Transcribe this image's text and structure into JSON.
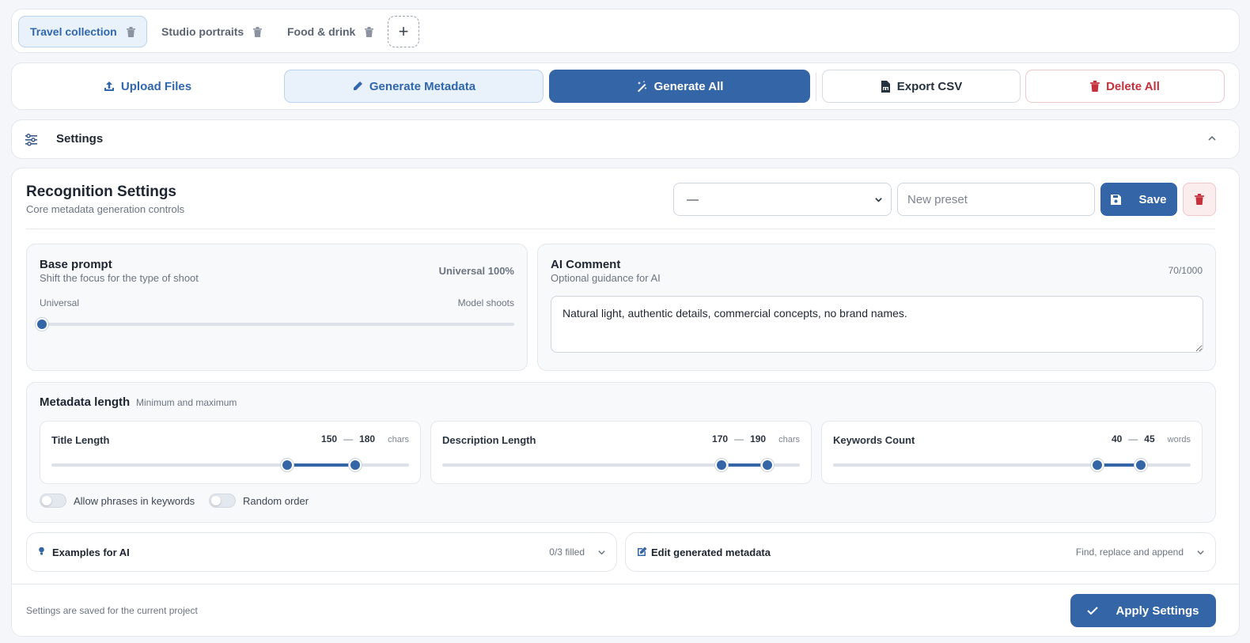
{
  "tabs": [
    {
      "label": "Travel collection",
      "active": true
    },
    {
      "label": "Studio portraits",
      "active": false
    },
    {
      "label": "Food & drink",
      "active": false
    }
  ],
  "add_tab_label": "+",
  "toolbar": {
    "upload_label": "Upload Files",
    "generate_metadata_label": "Generate Metadata",
    "generate_all_label": "Generate All",
    "export_label": "Export CSV",
    "delete_all_label": "Delete All"
  },
  "settings": {
    "title": "Settings"
  },
  "recognition": {
    "title": "Recognition Settings",
    "subtitle": "Core metadata generation controls",
    "preset_selected": "—",
    "preset_placeholder": "New preset",
    "save_label": "Save"
  },
  "base_prompt": {
    "title": "Base prompt",
    "subtitle": "Shift the focus for the type of shoot",
    "value_label": "Universal 100%",
    "left_label": "Universal",
    "right_label": "Model shoots",
    "slider_value": 0
  },
  "ai_comment": {
    "title": "AI Comment",
    "subtitle": "Optional guidance for AI",
    "counter": "70/1000",
    "text": "Natural light, authentic details, commercial concepts, no brand names."
  },
  "metadata_length": {
    "title": "Metadata length",
    "subtitle": "Minimum and maximum",
    "ranges": [
      {
        "label": "Title Length",
        "min": "150",
        "max": "180",
        "dash": "—",
        "unit": "chars",
        "fill_start": 0.66,
        "fill_end": 0.85
      },
      {
        "label": "Description Length",
        "min": "170",
        "max": "190",
        "dash": "—",
        "unit": "chars",
        "fill_start": 0.78,
        "fill_end": 0.91
      },
      {
        "label": "Keywords Count",
        "min": "40",
        "max": "45",
        "dash": "—",
        "unit": "words",
        "fill_start": 0.74,
        "fill_end": 0.86
      }
    ],
    "toggles": [
      {
        "label": "Allow phrases in keywords",
        "on": false
      },
      {
        "label": "Random order",
        "on": false
      }
    ]
  },
  "examples": {
    "title": "Examples for AI",
    "status": "0/3 filled"
  },
  "edit_metadata": {
    "title": "Edit generated metadata",
    "status": "Find, replace and append"
  },
  "footer": {
    "note": "Settings are saved for the current project",
    "apply_label": "Apply Settings"
  },
  "colors": {
    "accent": "#3465a7",
    "danger": "#c4313d",
    "accent_light": "#e9f1fb"
  },
  "icons": [
    "trash-icon",
    "plus-icon",
    "upload-icon",
    "pencil-icon",
    "magic-wand-icon",
    "csv-file-icon",
    "sliders-icon",
    "chevron-up-icon",
    "chevron-down-icon",
    "floppy-disk-icon",
    "lightbulb-icon",
    "edit-icon",
    "check-icon"
  ]
}
